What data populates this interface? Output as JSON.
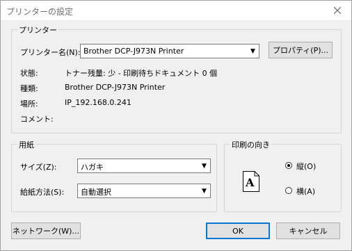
{
  "window": {
    "title": "プリンターの設定"
  },
  "printer_group": {
    "legend": "プリンター",
    "name_label": "プリンター名(N):",
    "name_value": "Brother DCP-J973N Printer",
    "properties_button": "プロパティ(P)...",
    "status_label": "状態:",
    "status_value": "トナー残量: 少 - 印刷待ちドキュメント 0 個",
    "type_label": "種類:",
    "type_value": "Brother DCP-J973N Printer",
    "where_label": "場所:",
    "where_value": "IP_192.168.0.241",
    "comment_label": "コメント:",
    "comment_value": ""
  },
  "paper_group": {
    "legend": "用紙",
    "size_label": "サイズ(Z):",
    "size_value": "ハガキ",
    "source_label": "給紙方法(S):",
    "source_value": "自動選択"
  },
  "orientation_group": {
    "legend": "印刷の向き",
    "portrait_label": "縦(O)",
    "landscape_label": "横(A)",
    "selected": "portrait",
    "preview_letter": "A"
  },
  "buttons": {
    "network": "ネットワーク(W)...",
    "ok": "OK",
    "cancel": "キャンセル"
  }
}
